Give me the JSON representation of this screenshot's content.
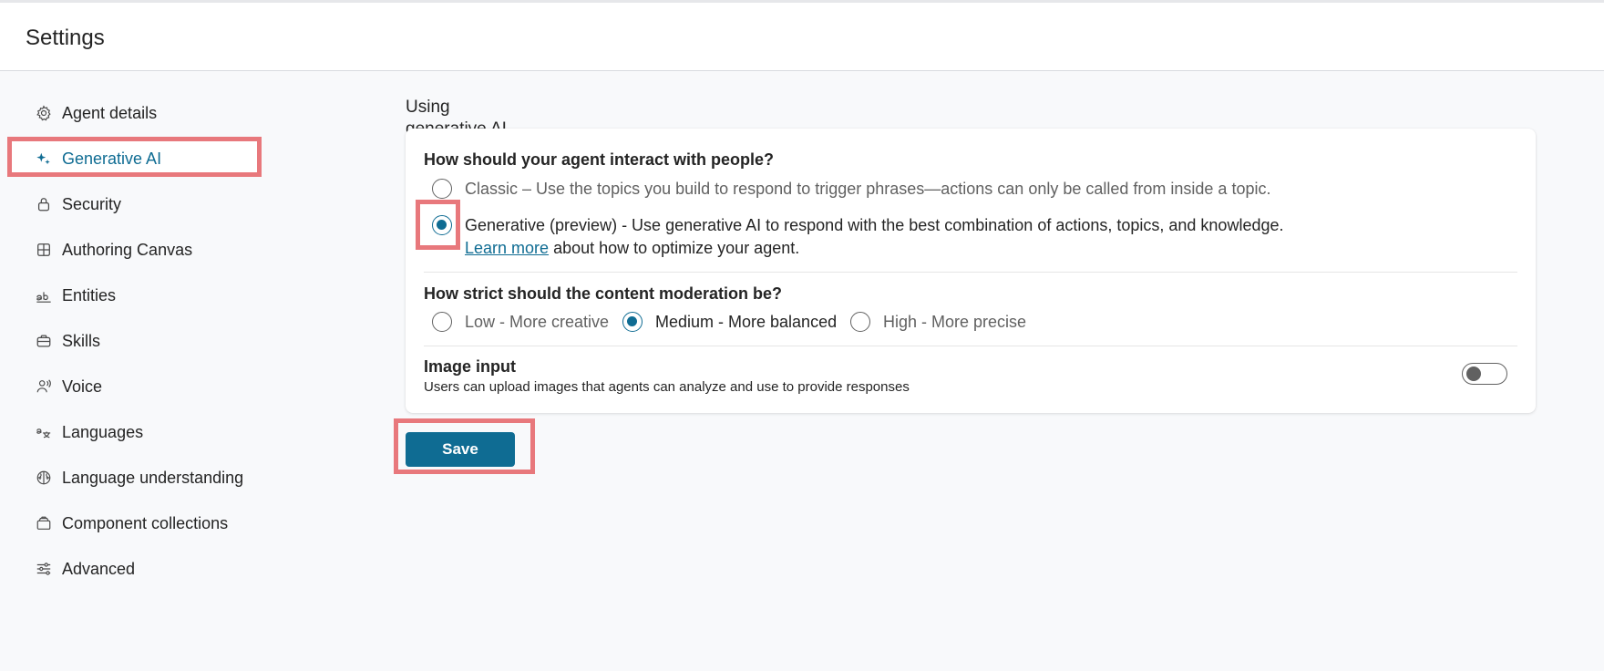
{
  "header": {
    "title": "Settings"
  },
  "sidebar": {
    "items": [
      {
        "label": "Agent details",
        "icon": "gear-icon"
      },
      {
        "label": "Generative AI",
        "icon": "sparkle-icon",
        "active": true
      },
      {
        "label": "Security",
        "icon": "lock-icon"
      },
      {
        "label": "Authoring Canvas",
        "icon": "grid-icon"
      },
      {
        "label": "Entities",
        "icon": "text-ab-icon"
      },
      {
        "label": "Skills",
        "icon": "briefcase-icon"
      },
      {
        "label": "Voice",
        "icon": "voice-icon"
      },
      {
        "label": "Languages",
        "icon": "translate-icon"
      },
      {
        "label": "Language understanding",
        "icon": "brain-icon"
      },
      {
        "label": "Component collections",
        "icon": "collection-icon"
      },
      {
        "label": "Advanced",
        "icon": "sliders-icon"
      }
    ]
  },
  "main": {
    "section_title": "Using generative AI in conversations",
    "interaction": {
      "question": "How should your agent interact with people?",
      "options": [
        {
          "label": "Classic – Use the topics you build to respond to trigger phrases—actions can only be called from inside a topic.",
          "selected": false
        },
        {
          "label": "Generative (preview) - Use generative AI to respond with the best combination of actions, topics, and knowledge.",
          "selected": true
        }
      ],
      "learn_more_link": "Learn more",
      "learn_more_suffix": " about how to optimize your agent."
    },
    "moderation": {
      "question": "How strict should the content moderation be?",
      "options": [
        {
          "label": "Low - More creative",
          "selected": false
        },
        {
          "label": "Medium - More balanced",
          "selected": true
        },
        {
          "label": "High - More precise",
          "selected": false
        }
      ]
    },
    "image_input": {
      "title": "Image input",
      "description": "Users can upload images that agents can analyze and use to provide responses",
      "enabled": false
    },
    "save_label": "Save"
  },
  "colors": {
    "accent": "#0f6c93",
    "highlight": "#e8787c",
    "background": "#f8f9fb"
  }
}
